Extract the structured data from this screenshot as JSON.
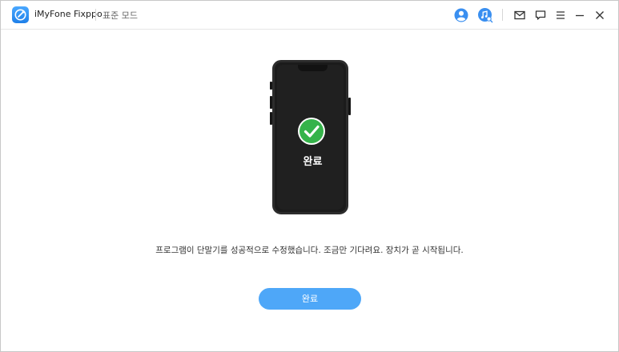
{
  "app": {
    "name": "iMyFone Fixppo",
    "mode": "표준 모드",
    "accent_color": "#4ea7f8"
  },
  "toolbar": {
    "account_icon": "user-icon",
    "music_icon": "music-search-icon",
    "mail_icon": "mail-icon",
    "feedback_icon": "chat-icon",
    "menu_icon": "menu-icon",
    "minimize_icon": "minimize-icon",
    "close_icon": "close-icon"
  },
  "phone": {
    "status": "완료",
    "check_color": "#35b34a"
  },
  "main": {
    "message": "프로그램이 단말기를 성공적으로 수정했습니다. 조금만 기다려요. 장치가 곧 시작됩니다.",
    "done_button_label": "완료"
  }
}
